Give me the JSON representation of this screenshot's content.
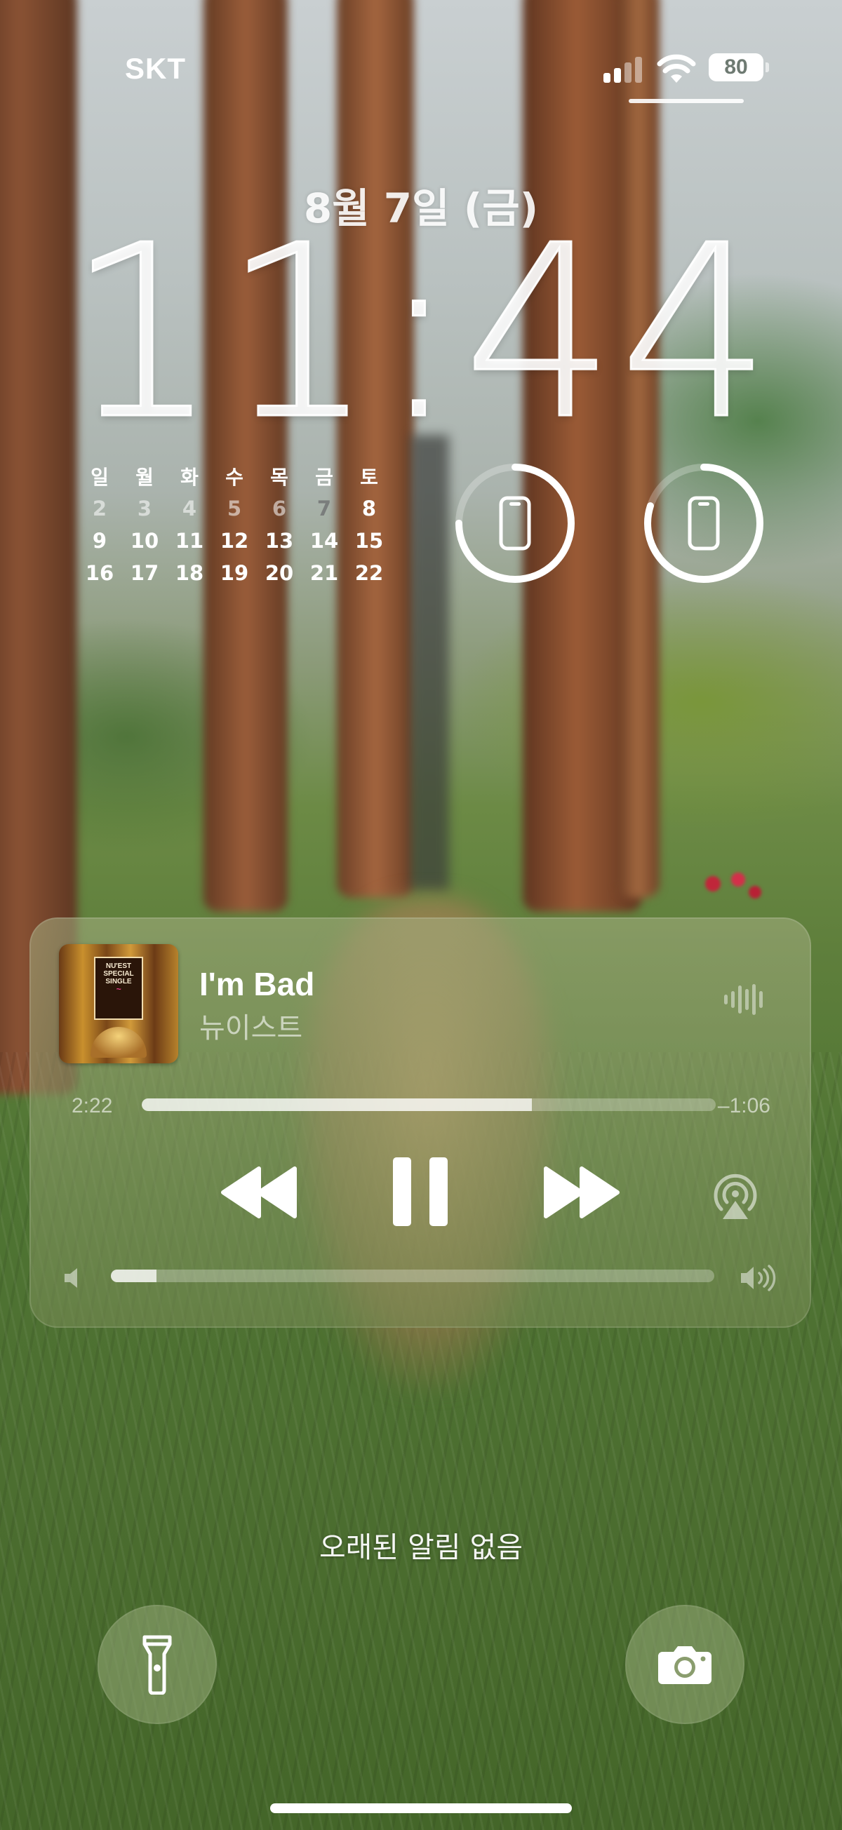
{
  "status_bar": {
    "carrier": "SKT",
    "battery_percent": "80",
    "signal_bars_active": 2,
    "signal_bars_total": 4
  },
  "lock_screen": {
    "date": "8월 7일 (금)",
    "time": "11:44"
  },
  "calendar": {
    "weekdays": [
      "일",
      "월",
      "화",
      "수",
      "목",
      "금",
      "토"
    ],
    "weeks": [
      [
        "2",
        "3",
        "4",
        "5",
        "6",
        "7",
        "8"
      ],
      [
        "9",
        "10",
        "11",
        "12",
        "13",
        "14",
        "15"
      ],
      [
        "16",
        "17",
        "18",
        "19",
        "20",
        "21",
        "22"
      ]
    ],
    "today": "7"
  },
  "device_batteries": [
    {
      "icon": "iphone-icon",
      "level": 0.75
    },
    {
      "icon": "iphone-icon",
      "level": 0.8
    }
  ],
  "now_playing": {
    "title": "I'm Bad",
    "artist": "뉴이스트",
    "album_art_text": [
      "NU'EST",
      "SPECIAL",
      "SINGLE"
    ],
    "elapsed": "2:22",
    "remaining": "–1:06",
    "progress": 0.68,
    "volume": 0.075
  },
  "notifications": {
    "empty_text": "오래된 알림 없음"
  },
  "colors": {
    "player_tint": "#8f9f6a",
    "today_highlight": "#ebebeb"
  }
}
